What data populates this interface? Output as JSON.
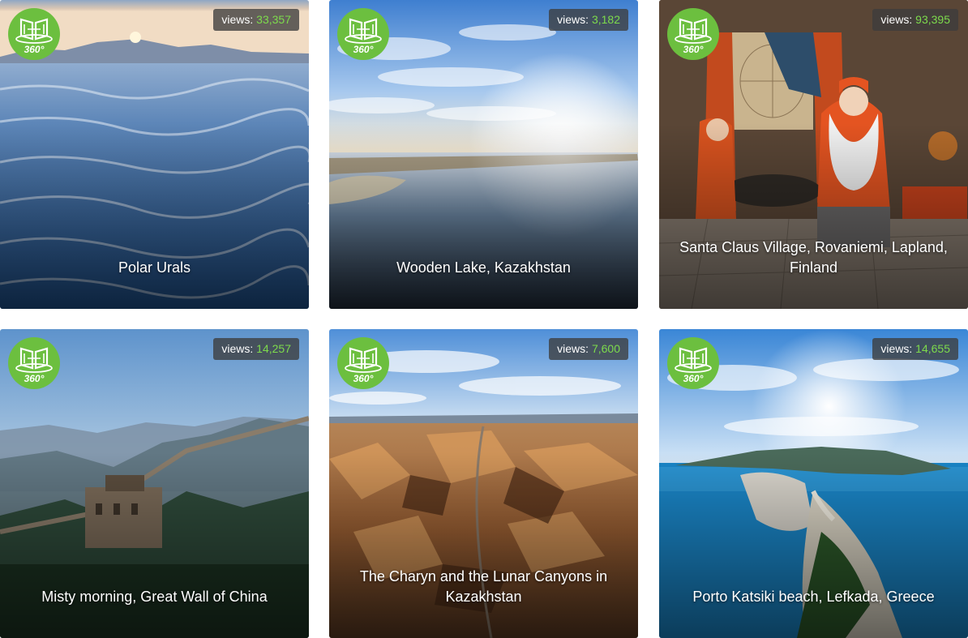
{
  "cards": [
    {
      "title": "Polar Urals",
      "views_label": "views:",
      "views": "33,357"
    },
    {
      "title": "Wooden Lake, Kazakhstan",
      "views_label": "views:",
      "views": "3,182"
    },
    {
      "title": "Santa Claus Village, Rovaniemi, Lapland, Finland",
      "views_label": "views:",
      "views": "93,395"
    },
    {
      "title": "Misty morning, Great Wall of China",
      "views_label": "views:",
      "views": "14,257"
    },
    {
      "title": "The Charyn and the Lunar Canyons in Kazakhstan",
      "views_label": "views:",
      "views": "7,600"
    },
    {
      "title": "Porto Katsiki beach, Lefkada, Greece",
      "views_label": "views:",
      "views": "14,655"
    }
  ],
  "badge": {
    "label": "360°",
    "color": "#6cbf3f",
    "icon": "panorama-360-icon"
  },
  "colors": {
    "views_count": "#7ddb4c",
    "views_bg": "#3c3c3c"
  }
}
